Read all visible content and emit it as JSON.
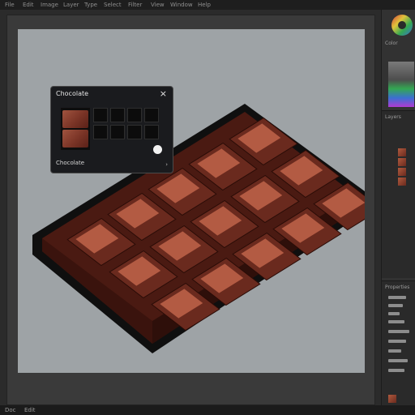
{
  "menubar": {
    "items": [
      "File",
      "Edit",
      "Image",
      "Layer",
      "Type",
      "Select",
      "Filter",
      "View",
      "Window",
      "Help"
    ]
  },
  "popup": {
    "title": "Chocolate",
    "footer_label": "Chocolate",
    "close_symbol": "×"
  },
  "canvas": {
    "background": "#9ea3a6"
  },
  "chocolate_bar": {
    "rows": 3,
    "cols": 5,
    "base_color": "#6a2a1e",
    "highlight_color": "#c0644a",
    "outline_color": "#0f0f0f"
  },
  "statusbar": {
    "left": "Doc",
    "mid": "Edit"
  },
  "right_panel": {
    "tab_color": "Color",
    "tab_layers": "Layers",
    "tab_properties": "Properties"
  },
  "colors": {
    "accent_red": "#d23b3b",
    "accent_green": "#33a852",
    "accent_blue": "#3b6fd2",
    "accent_purple": "#b03bd2"
  }
}
